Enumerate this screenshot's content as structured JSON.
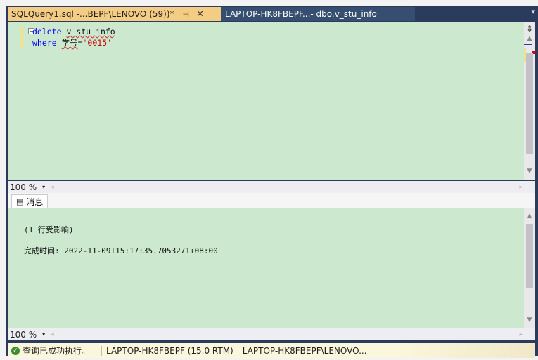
{
  "tabs": {
    "active_label": "SQLQuery1.sql -...BEPF\\LENOVO (59))*",
    "pin_glyph": "⊣",
    "close_glyph": "✕",
    "inactive_label": "LAPTOP-HK8FBEPF...- dbo.v_stu_info",
    "menu_glyph": "▾"
  },
  "editor": {
    "line1_kw": "delete",
    "line1_ident": "v_stu_info",
    "line2_kw": "where",
    "line2_col": "学号",
    "line2_eq": "=",
    "line2_str": "'0015'",
    "collapse_glyph": "−"
  },
  "zoom": {
    "value": "100 %",
    "drop_glyph": "▾",
    "left_glyph": "◂",
    "right_glyph": "▸"
  },
  "results": {
    "tab_label": "消息",
    "line1": "(1 行受影响)",
    "line2": "完成时间: 2022-11-09T15:17:35.7053271+08:00"
  },
  "status": {
    "message": "查询已成功执行。",
    "server": "LAPTOP-HK8FBEPF (15.0 RTM)",
    "user": "LAPTOP-HK8FBEPF\\LENOVO..."
  },
  "colors": {
    "active_tab": "#f5cc84",
    "editor_bg": "#cce8cf",
    "frame": "#2b3b5b"
  }
}
